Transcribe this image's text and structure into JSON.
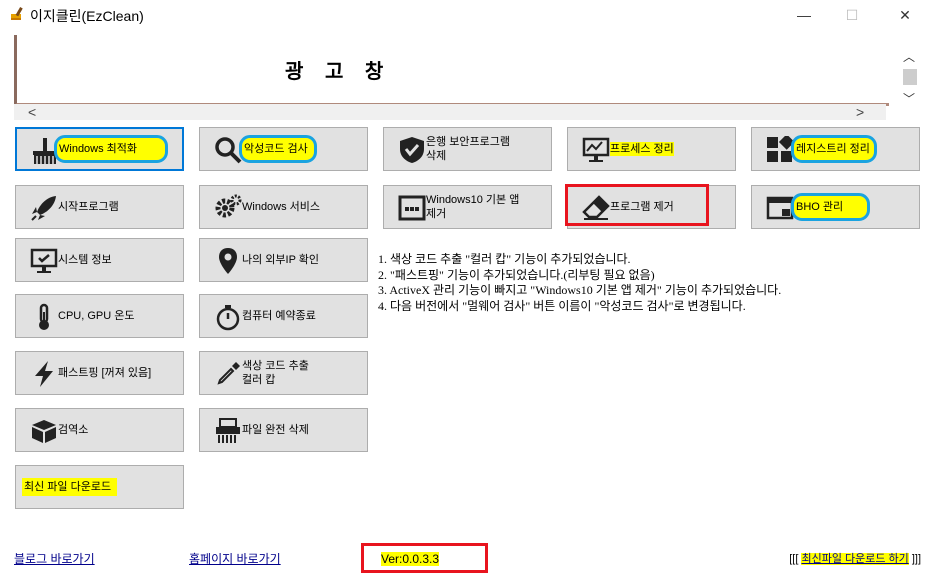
{
  "window": {
    "title": "이지클린(EzClean)",
    "minimize": "—",
    "maximize": "☐",
    "close": "✕"
  },
  "ad": {
    "text": "광 고 창"
  },
  "buttons": [
    {
      "label": "Windows 최적화"
    },
    {
      "label": "악성코드 검사"
    },
    {
      "label": "은행 보안프로그램\n삭제"
    },
    {
      "label": "프로세스 정리"
    },
    {
      "label": "레지스트리 정리"
    },
    {
      "label": "시작프로그램"
    },
    {
      "label": "Windows 서비스"
    },
    {
      "label": "Windows10 기본 앱\n제거"
    },
    {
      "label": "프로그램 제거"
    },
    {
      "label": "BHO 관리"
    },
    {
      "label": "시스템 정보"
    },
    {
      "label": "나의 외부IP 확인"
    },
    {
      "label": "CPU, GPU 온도"
    },
    {
      "label": "컴퓨터 예약종료"
    },
    {
      "label": "패스트핑 [꺼져 있음]"
    },
    {
      "label": "색상 코드 추출\n컬러 캅"
    },
    {
      "label": "검역소"
    },
    {
      "label": "파일 완전 삭제"
    },
    {
      "label": "최신 파일 다운로드"
    }
  ],
  "notes": [
    "1. 색상 코드 추출 \"컬러 캅\" 기능이 추가되었습니다.",
    "2. \"패스트핑\" 기능이 추가되었습니다.(리부팅 필요 없음)",
    "3. ActiveX 관리 기능이 빠지고 \"Windows10 기본 앱 제거\" 기능이 추가되었습니다.",
    "4. 다음 버전에서 \"멀웨어 검사\" 버튼 이름이 \"악성코드 검사\"로 변경됩니다."
  ],
  "footer": {
    "blog_link": "블로그 바로가기",
    "homepage_link": "홈페이지 바로가기",
    "version": "Ver:0.0.3.3",
    "download_prefix": "[[[",
    "download_link": "최신파일 다운로드 하기",
    "download_suffix": "]]]"
  },
  "highlight_colors": {
    "yellow": "#ffff00",
    "blue_ring": "#1aa3e0",
    "red_box": "#e8141e"
  }
}
